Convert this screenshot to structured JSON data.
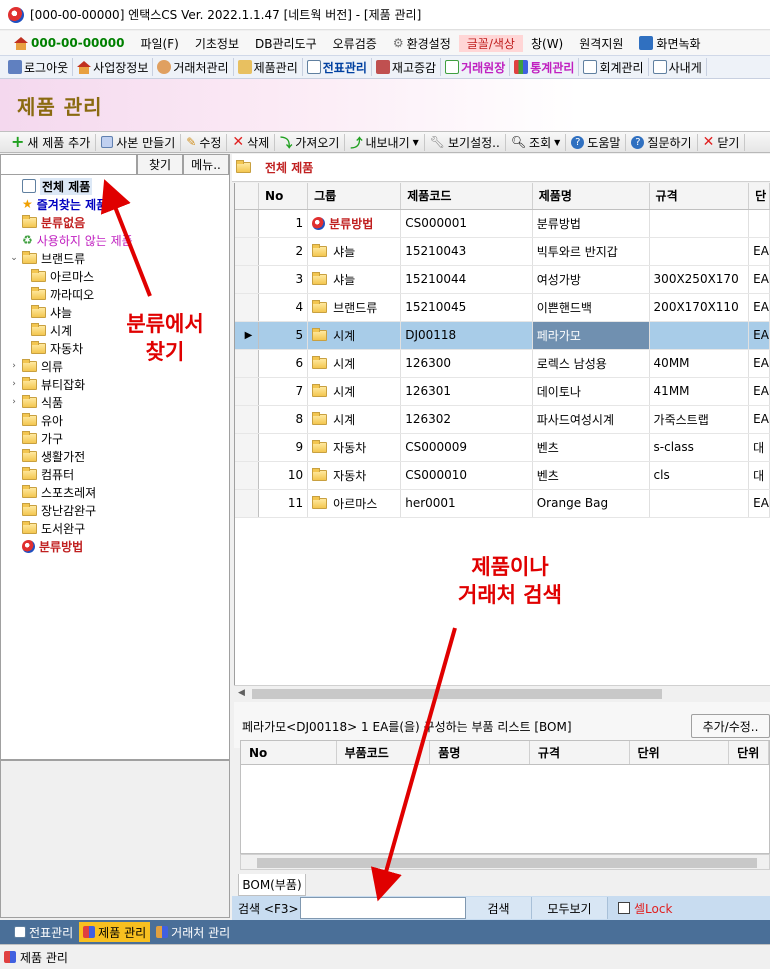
{
  "window": {
    "title": "[000-00-00000] 엔택스CS Ver. 2022.1.1.47 [네트웍 버전] - [제품 관리]"
  },
  "menu": {
    "company": "000-00-00000",
    "items": [
      "파일(F)",
      "기초정보",
      "DB관리도구",
      "오류검증",
      "환경설정",
      "글꼴/색상",
      "창(W)",
      "원격지원",
      "화면녹화"
    ]
  },
  "toolbar": {
    "items": [
      "로그아웃",
      "사업장정보",
      "거래처관리",
      "제품관리",
      "전표관리",
      "재고증감",
      "거래원장",
      "통계관리",
      "회계관리",
      "사내게"
    ]
  },
  "header": {
    "title": "제품 관리"
  },
  "actions": [
    "새 제품 추가",
    "사본 만들기",
    "수정",
    "삭제",
    "가져오기",
    "내보내기",
    "보기설정..",
    "조회",
    "도움말",
    "질문하기",
    "닫기"
  ],
  "left": {
    "find_label": "찾기",
    "menu_label": "메뉴..",
    "tree": [
      {
        "label": "전체 제품",
        "color": "#000000",
        "indent": 0,
        "kind": "root"
      },
      {
        "label": "즐겨찾는 제품",
        "color": "#0000c0",
        "indent": 0,
        "kind": "star"
      },
      {
        "label": "분류없음",
        "color": "#c02020",
        "indent": 0,
        "kind": "folder"
      },
      {
        "label": "사용하지 않는 제품",
        "color": "#c020c0",
        "indent": 0,
        "kind": "bin"
      },
      {
        "label": "브랜드류",
        "color": "#000000",
        "indent": 0,
        "kind": "folder",
        "expanded": true
      },
      {
        "label": "아르마스",
        "color": "#000000",
        "indent": 1,
        "kind": "folder"
      },
      {
        "label": "까라띠오",
        "color": "#000000",
        "indent": 1,
        "kind": "folder"
      },
      {
        "label": "샤늘",
        "color": "#000000",
        "indent": 1,
        "kind": "folder"
      },
      {
        "label": "시계",
        "color": "#000000",
        "indent": 1,
        "kind": "folder"
      },
      {
        "label": "자동차",
        "color": "#000000",
        "indent": 1,
        "kind": "folder"
      },
      {
        "label": "의류",
        "color": "#000000",
        "indent": 0,
        "kind": "folder",
        "collapsed": true
      },
      {
        "label": "뷰티잡화",
        "color": "#000000",
        "indent": 0,
        "kind": "folder",
        "collapsed": true
      },
      {
        "label": "식품",
        "color": "#000000",
        "indent": 0,
        "kind": "folder",
        "collapsed": true
      },
      {
        "label": "유아",
        "color": "#000000",
        "indent": 0,
        "kind": "folder"
      },
      {
        "label": "가구",
        "color": "#000000",
        "indent": 0,
        "kind": "folder"
      },
      {
        "label": "생활가전",
        "color": "#000000",
        "indent": 0,
        "kind": "folder"
      },
      {
        "label": "컴퓨터",
        "color": "#000000",
        "indent": 0,
        "kind": "folder"
      },
      {
        "label": "스포츠레져",
        "color": "#000000",
        "indent": 0,
        "kind": "folder"
      },
      {
        "label": "장난감완구",
        "color": "#000000",
        "indent": 0,
        "kind": "folder"
      },
      {
        "label": "도서완구",
        "color": "#000000",
        "indent": 0,
        "kind": "folder"
      },
      {
        "label": "분류방법",
        "color": "#c02020",
        "indent": 0,
        "kind": "method"
      }
    ]
  },
  "right": {
    "folder_title": "전체 제품",
    "columns": [
      "No",
      "그룹",
      "제품코드",
      "제품명",
      "규격",
      "단"
    ],
    "rows": [
      {
        "no": "1",
        "group": "분류방법",
        "code": "CS000001",
        "name": "분류방법",
        "spec": "",
        "unit": "",
        "special": true
      },
      {
        "no": "2",
        "group": "샤늘",
        "code": "15210043",
        "name": "빅투와르 반지갑",
        "spec": "",
        "unit": "EA"
      },
      {
        "no": "3",
        "group": "샤늘",
        "code": "15210044",
        "name": "여성가방",
        "spec": "300X250X170",
        "unit": "EA"
      },
      {
        "no": "4",
        "group": "브랜드류",
        "code": "15210045",
        "name": "이쁜핸드백",
        "spec": "200X170X110",
        "unit": "EA"
      },
      {
        "no": "5",
        "group": "시계",
        "code": "DJ00118",
        "name": "페라가모",
        "spec": "",
        "unit": "EA",
        "selected": true
      },
      {
        "no": "6",
        "group": "시계",
        "code": "126300",
        "name": "로렉스 남성용",
        "spec": "40MM",
        "unit": "EA"
      },
      {
        "no": "7",
        "group": "시계",
        "code": "126301",
        "name": "데이토나",
        "spec": "41MM",
        "unit": "EA"
      },
      {
        "no": "8",
        "group": "시계",
        "code": "126302",
        "name": "파사드여성시계",
        "spec": "가죽스트랩",
        "unit": "EA"
      },
      {
        "no": "9",
        "group": "자동차",
        "code": "CS000009",
        "name": "벤츠",
        "spec": "s-class",
        "unit": "대"
      },
      {
        "no": "10",
        "group": "자동차",
        "code": "CS000010",
        "name": "벤츠",
        "spec": "cls",
        "unit": "대"
      },
      {
        "no": "11",
        "group": "아르마스",
        "code": "her0001",
        "name": "Orange Bag",
        "spec": "",
        "unit": "EA"
      }
    ]
  },
  "bom": {
    "label": "페라가모<DJ00118> 1 EA를(을) 구성하는 부품 리스트 [BOM]",
    "add_button": "추가/수정..",
    "columns": [
      "No",
      "부품코드",
      "품명",
      "규격",
      "단위",
      "단위"
    ],
    "tab": "BOM(부품)"
  },
  "search": {
    "label": "검색 <F3>",
    "value": "",
    "search_button": "검색",
    "show_all_button": "모두보기",
    "lock_label": "셀Lock"
  },
  "taskbar": [
    "전표관리",
    "제품 관리",
    "거래처 관리"
  ],
  "status": "제품 관리",
  "annotations": {
    "tree_hint": "분류에서\n찾기",
    "search_hint": "제품이나\n거래처 검색"
  }
}
